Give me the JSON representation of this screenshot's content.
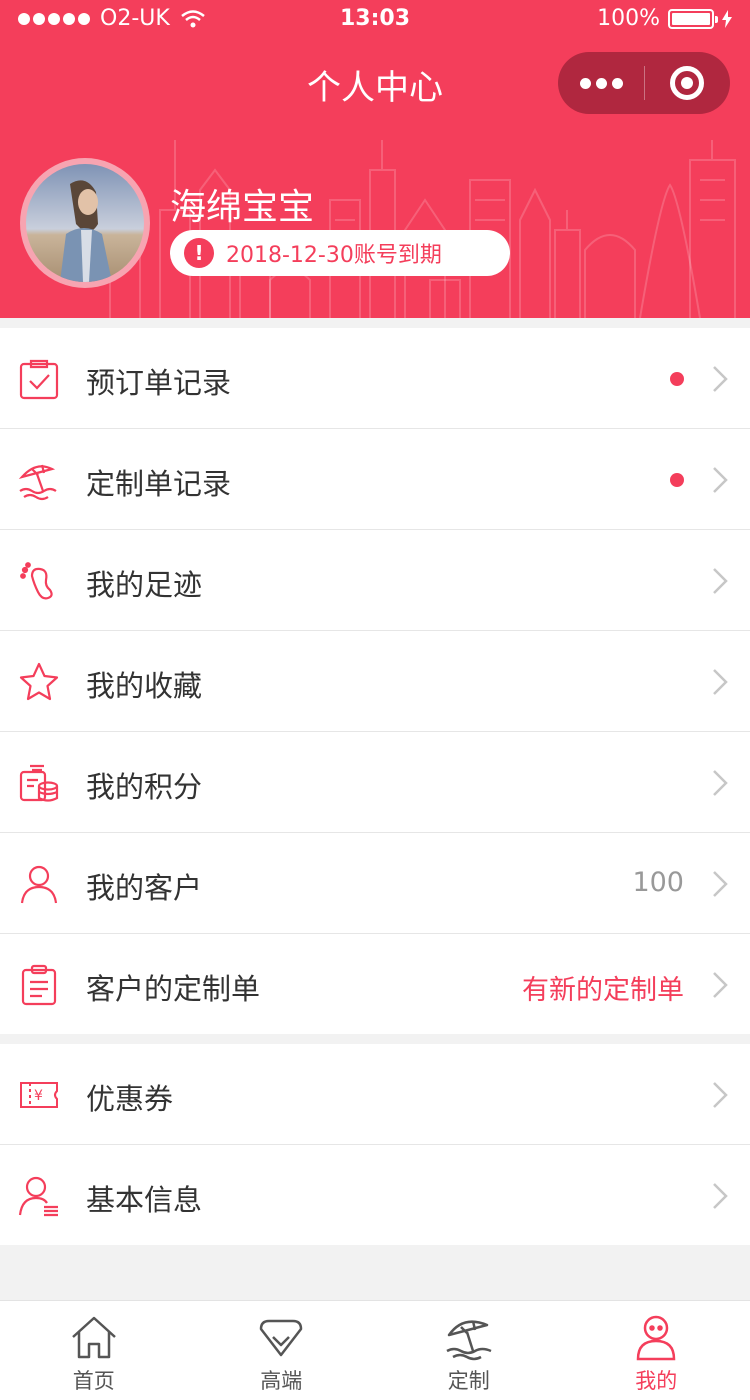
{
  "status_bar": {
    "carrier": "O2-UK",
    "time": "13:03",
    "battery": "100%"
  },
  "nav": {
    "title": "个人中心"
  },
  "profile": {
    "name": "海绵宝宝",
    "expire_text": "2018-12-30账号到期"
  },
  "menu_groups": [
    [
      {
        "label": "预订单记录",
        "icon": "booking-icon",
        "dot": true
      },
      {
        "label": "定制单记录",
        "icon": "beach-umbrella-icon",
        "dot": true
      },
      {
        "label": "我的足迹",
        "icon": "footprint-icon"
      },
      {
        "label": "我的收藏",
        "icon": "star-icon"
      },
      {
        "label": "我的积分",
        "icon": "coins-icon"
      },
      {
        "label": "我的客户",
        "icon": "user-icon",
        "value": "100"
      },
      {
        "label": "客户的定制单",
        "icon": "clipboard-icon",
        "value": "有新的定制单",
        "value_highlight": true
      }
    ],
    [
      {
        "label": "优惠券",
        "icon": "coupon-icon"
      },
      {
        "label": "基本信息",
        "icon": "user-info-icon"
      }
    ]
  ],
  "tabs": [
    {
      "label": "首页",
      "icon": "home-icon"
    },
    {
      "label": "高端",
      "icon": "diamond-icon"
    },
    {
      "label": "定制",
      "icon": "beach-umbrella-icon"
    },
    {
      "label": "我的",
      "icon": "profile-icon",
      "active": true
    }
  ],
  "colors": {
    "accent": "#f43e5b",
    "text": "#333333",
    "muted": "#999999"
  }
}
